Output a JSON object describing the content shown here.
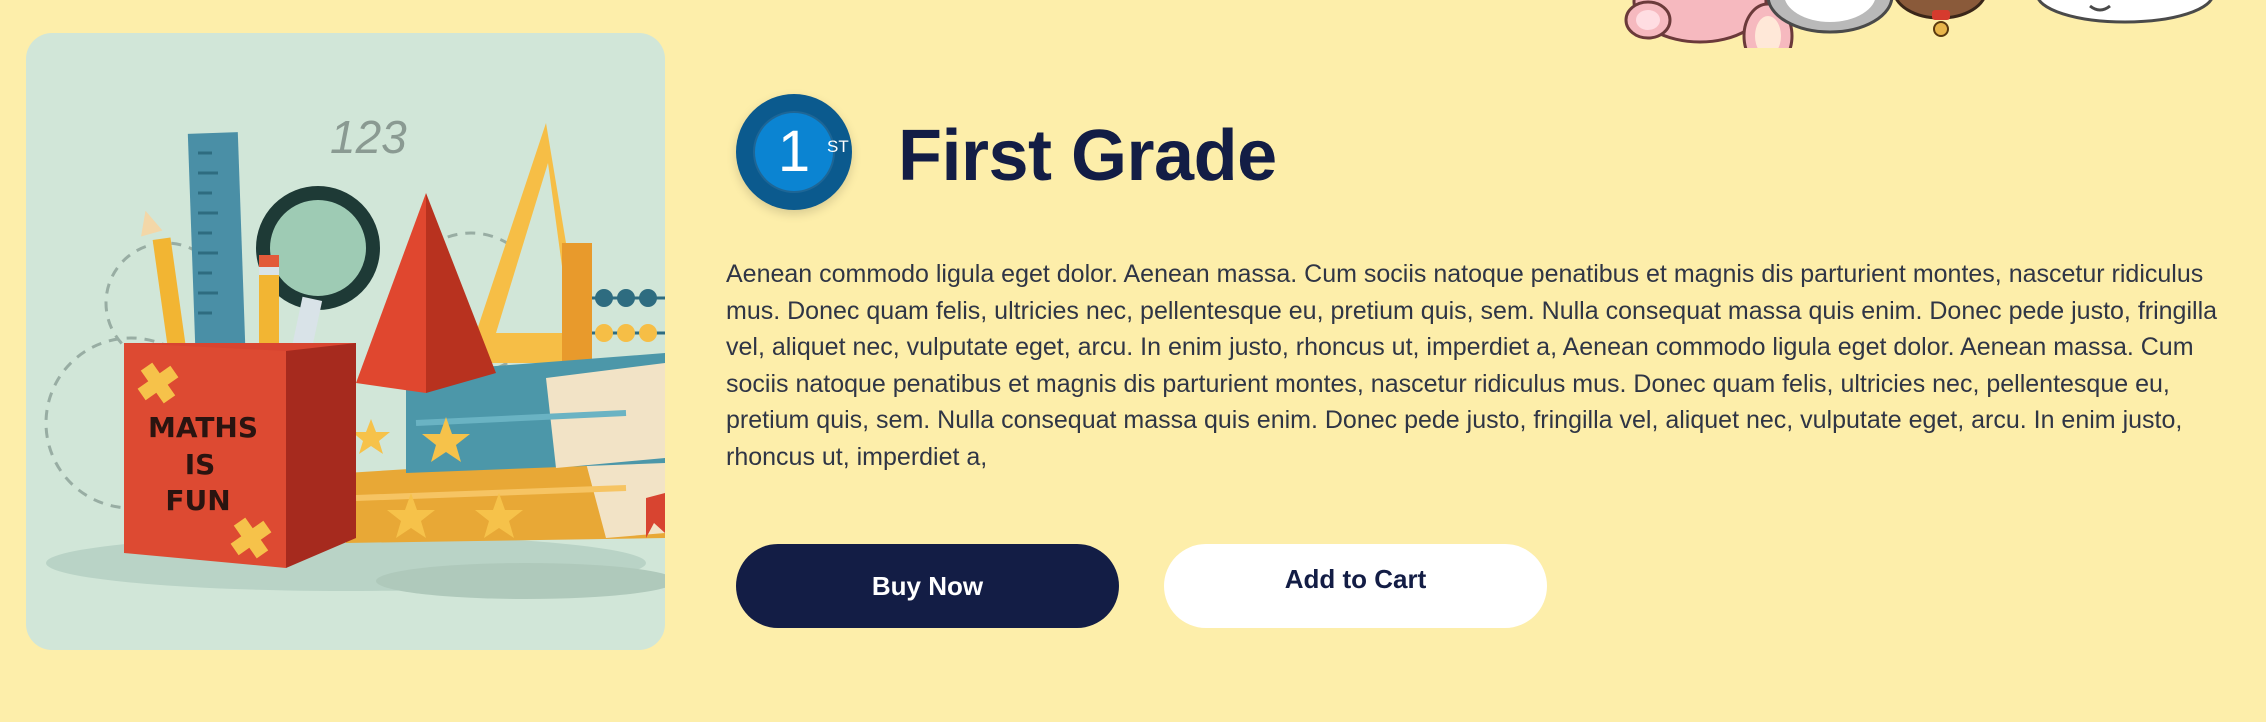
{
  "product": {
    "badge_number": "1",
    "badge_suffix": "ST",
    "title": "First Grade",
    "description": "Aenean commodo ligula eget dolor. Aenean massa. Cum sociis natoque penatibus et magnis dis parturient montes, nascetur ridiculus mus. Donec quam felis, ultricies nec, pellentesque eu, pretium quis, sem. Nulla consequat massa quis enim. Donec pede justo, fringilla vel, aliquet nec, vulputate eget, arcu. In enim justo, rhoncus ut, imperdiet a, Aenean commodo ligula eget dolor. Aenean massa. Cum sociis natoque penatibus et magnis dis parturient montes, nascetur ridiculus mus. Donec quam felis, ultricies nec, pellentesque eu, pretium quis, sem. Nulla consequat massa quis enim. Donec pede justo, fringilla vel, aliquet nec, vulputate eget, arcu. In enim justo, rhoncus ut, imperdiet a,"
  },
  "illustration": {
    "numbers_text": "123",
    "box_line_1": "MATHS",
    "box_line_2": "IS",
    "box_line_3": "FUN"
  },
  "actions": {
    "buy_label": "Buy Now",
    "cart_label": "Add to Cart"
  },
  "colors": {
    "background": "#FDEEAA",
    "navy": "#131D45",
    "badge_blue": "#0B84D2",
    "image_bg": "#D1E6D8"
  }
}
